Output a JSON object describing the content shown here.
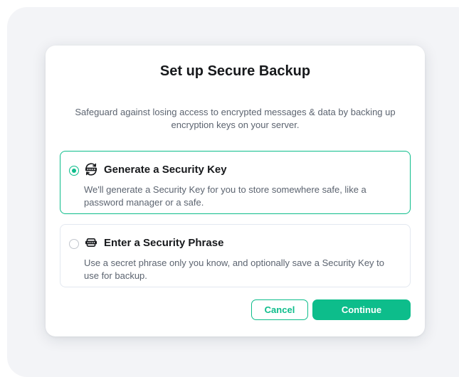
{
  "dialog": {
    "title": "Set up Secure Backup",
    "description": "Safeguard against losing access to encrypted messages & data by backing up encryption keys on your server.",
    "options": [
      {
        "title": "Generate a Security Key",
        "description": "We'll generate a Security Key for you to store somewhere safe, like a password manager or a safe.",
        "selected": true,
        "icon": "key-icon"
      },
      {
        "title": "Enter a Security Phrase",
        "description": "Use a secret phrase only you know, and optionally save a Security Key to use for backup.",
        "selected": false,
        "icon": "password-icon"
      }
    ],
    "buttons": {
      "cancel_label": "Cancel",
      "continue_label": "Continue"
    }
  },
  "colors": {
    "accent": "#0dbd8b",
    "text_primary": "#17191c",
    "text_secondary": "#5c6470",
    "border": "#e3e8f0",
    "backdrop": "#f3f4f7"
  }
}
